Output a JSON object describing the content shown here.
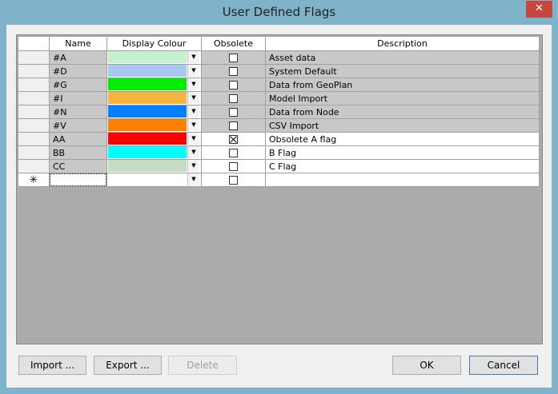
{
  "window": {
    "title": "User Defined Flags",
    "close_glyph": "✕"
  },
  "columns": [
    "Name",
    "Display Colour",
    "Obsolete",
    "Description"
  ],
  "rows": [
    {
      "name": "#A",
      "color": "#c6efce",
      "obsolete": false,
      "description": "Asset data",
      "locked": true
    },
    {
      "name": "#D",
      "color": "#a8c8ee",
      "obsolete": false,
      "description": "System Default",
      "locked": true
    },
    {
      "name": "#G",
      "color": "#00ee00",
      "obsolete": false,
      "description": "Data from GeoPlan",
      "locked": true
    },
    {
      "name": "#I",
      "color": "#f5b540",
      "obsolete": false,
      "description": "Model Import",
      "locked": true
    },
    {
      "name": "#N",
      "color": "#0080ff",
      "obsolete": false,
      "description": "Data from Node",
      "locked": true
    },
    {
      "name": "#V",
      "color": "#ff8000",
      "obsolete": false,
      "description": "CSV Import",
      "locked": true
    },
    {
      "name": "AA",
      "color": "#ff0000",
      "obsolete": true,
      "description": "Obsolete A flag",
      "locked": false
    },
    {
      "name": "BB",
      "color": "#00ffff",
      "obsolete": false,
      "description": "B Flag",
      "locked": false
    },
    {
      "name": "CC",
      "color": "#c4dcc4",
      "obsolete": false,
      "description": "C Flag",
      "locked": false
    }
  ],
  "new_row": {
    "marker": "✳",
    "name": "",
    "description": ""
  },
  "buttons": {
    "import": "Import ...",
    "export": "Export ...",
    "delete": "Delete",
    "ok": "OK",
    "cancel": "Cancel"
  }
}
